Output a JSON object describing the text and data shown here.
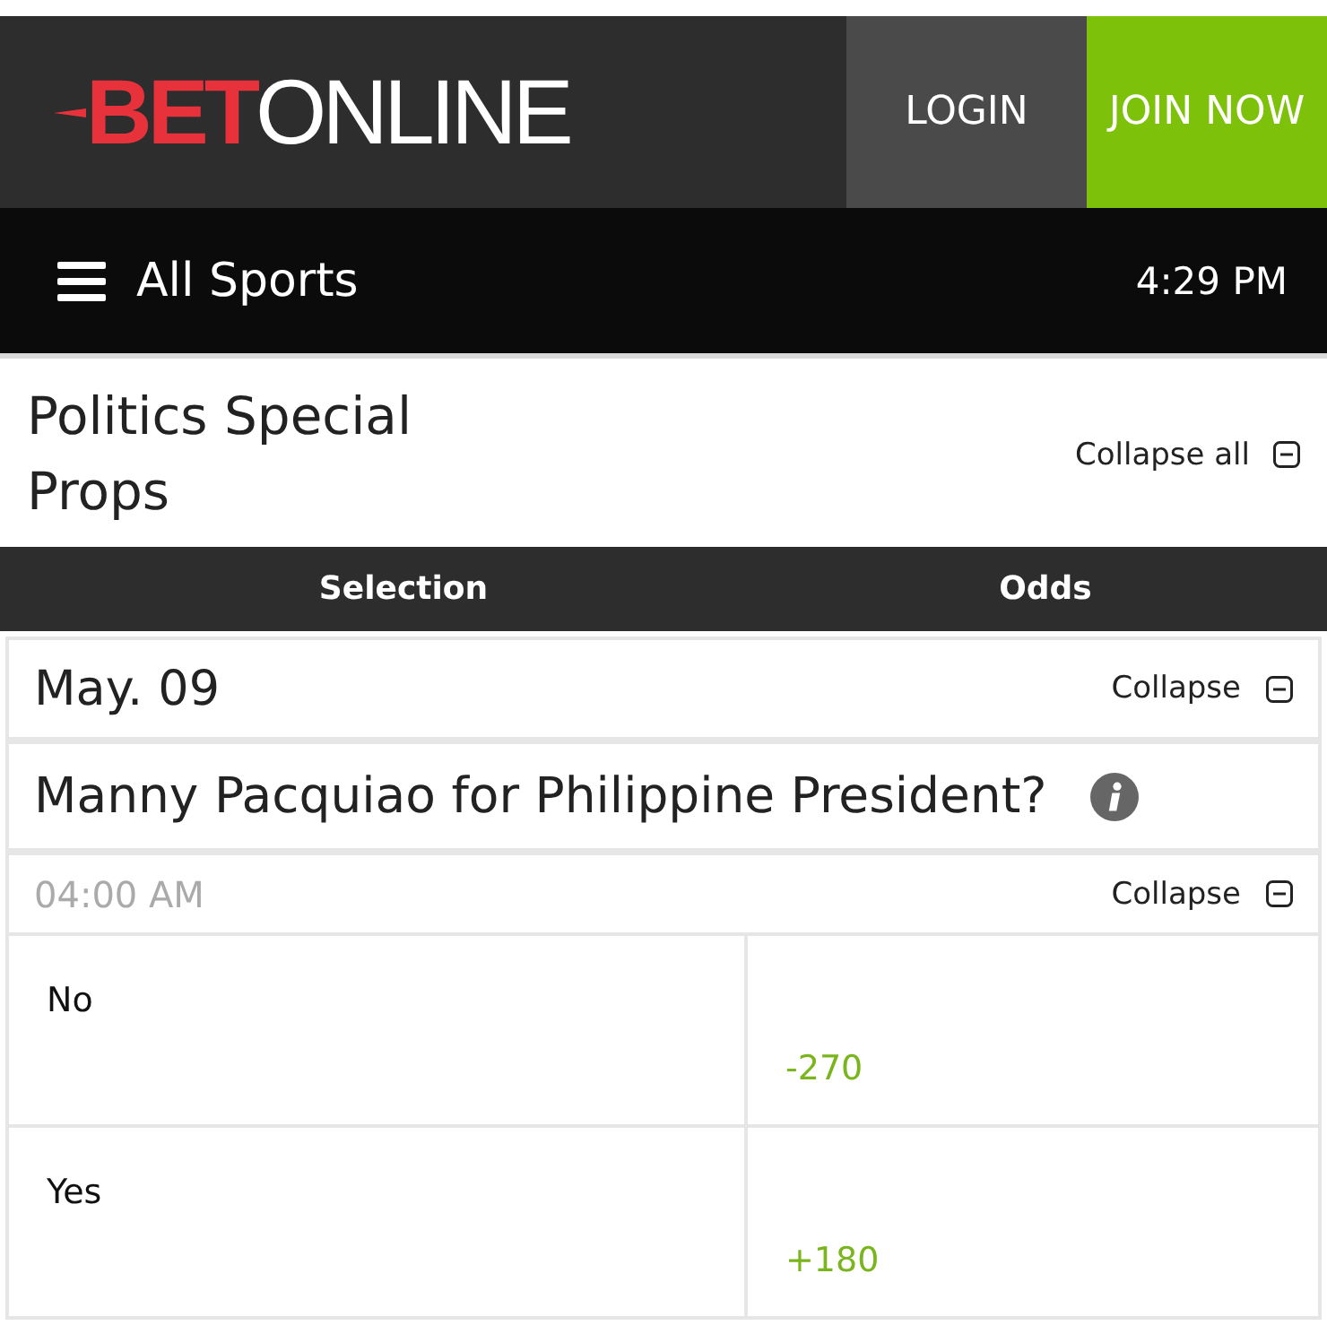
{
  "header": {
    "logo": {
      "accent": "BET",
      "rest": "ONLINE"
    },
    "buttons": [
      {
        "label": "LOGIN",
        "kind": "login"
      },
      {
        "label": "JOIN NOW",
        "kind": "join"
      }
    ]
  },
  "nav": {
    "label": "All Sports",
    "time": "4:29 PM"
  },
  "page": {
    "title": "Politics Special Props",
    "collapse_all": "Collapse all",
    "expanded": true
  },
  "table": {
    "columns": [
      "Selection",
      "Odds"
    ]
  },
  "groups": [
    {
      "date": "May. 09",
      "collapse": "Collapse",
      "expanded": true,
      "events": [
        {
          "question": "Manny Pacquiao for Philippine President?",
          "time": "04:00 AM",
          "collapse": "Collapse",
          "expanded": true,
          "rows": [
            {
              "selection": "No",
              "odds": "-270"
            },
            {
              "selection": "Yes",
              "odds": "+180"
            }
          ]
        }
      ]
    }
  ]
}
